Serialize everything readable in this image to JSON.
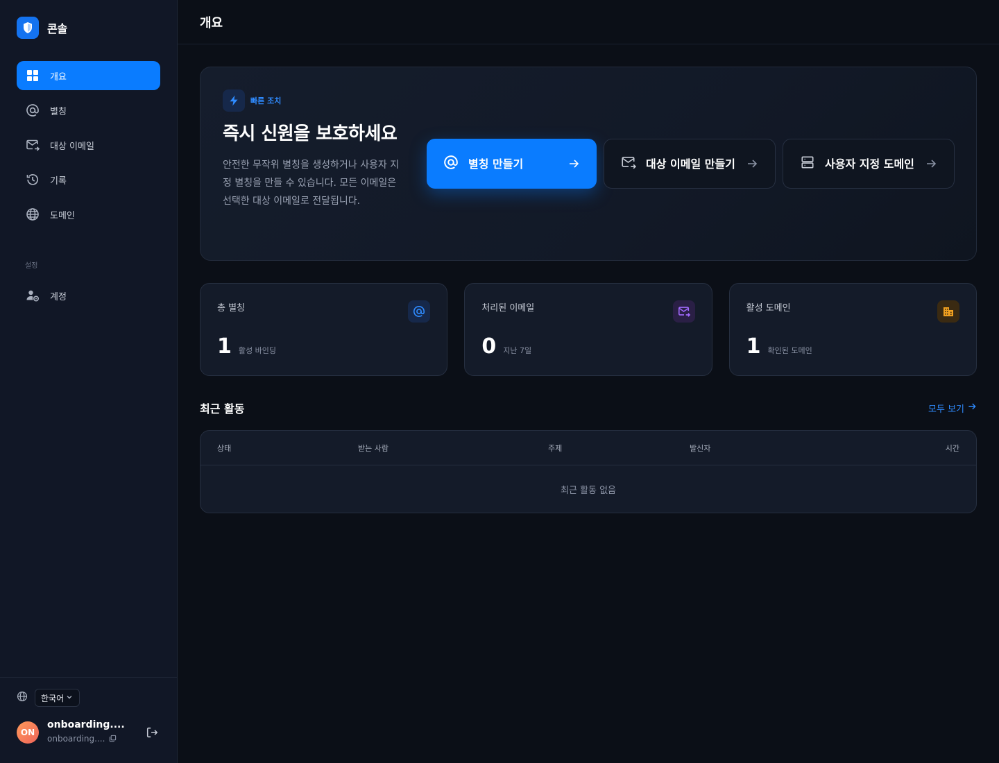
{
  "brand": {
    "name": "콘솔"
  },
  "sidebar": {
    "items": [
      {
        "label": "개요",
        "icon": "grid-icon",
        "active": true
      },
      {
        "label": "별칭",
        "icon": "at-icon"
      },
      {
        "label": "대상 이메일",
        "icon": "mail-forward-icon"
      },
      {
        "label": "기록",
        "icon": "history-icon"
      },
      {
        "label": "도메인",
        "icon": "globe-icon"
      }
    ],
    "section_label": "설정",
    "settings_items": [
      {
        "label": "계정",
        "icon": "user-gear-icon"
      }
    ]
  },
  "footer": {
    "language": "한국어",
    "user": {
      "initials": "ON",
      "name": "onboarding....",
      "email": "onboarding...."
    }
  },
  "header": {
    "title": "개요"
  },
  "hero": {
    "badge": "빠른 조치",
    "title": "즉시 신원을 보호하세요",
    "description": "안전한 무작위 별칭을 생성하거나 사용자 지정 별칭을 만들 수 있습니다. 모든 이메일은 선택한 대상 이메일로 전달됩니다.",
    "actions": [
      {
        "label": "별칭 만들기",
        "icon": "at-icon"
      },
      {
        "label": "대상 이메일 만들기",
        "icon": "mail-forward-icon"
      },
      {
        "label": "사용자 지정 도메인",
        "icon": "server-icon"
      }
    ]
  },
  "stats": [
    {
      "label": "총 별칭",
      "value": "1",
      "sub": "활성 바인딩",
      "icon": "at-icon",
      "color": "#2f8bff",
      "bg": "#16284a"
    },
    {
      "label": "처리된 이메일",
      "value": "0",
      "sub": "지난 7일",
      "icon": "mail-forward-icon",
      "color": "#a36bff",
      "bg": "#2a1f45"
    },
    {
      "label": "활성 도메인",
      "value": "1",
      "sub": "확인된 도메인",
      "icon": "building-icon",
      "color": "#f0a020",
      "bg": "#3a2a12"
    }
  ],
  "recent": {
    "title": "최근 활동",
    "view_all": "모두 보기",
    "columns": [
      "상태",
      "받는 사람",
      "주제",
      "발신자",
      "시간"
    ],
    "empty": "최근 활동 없음"
  },
  "colors": {
    "accent": "#0a7cff",
    "background": "#0b0f17",
    "sidebar": "#111726"
  }
}
